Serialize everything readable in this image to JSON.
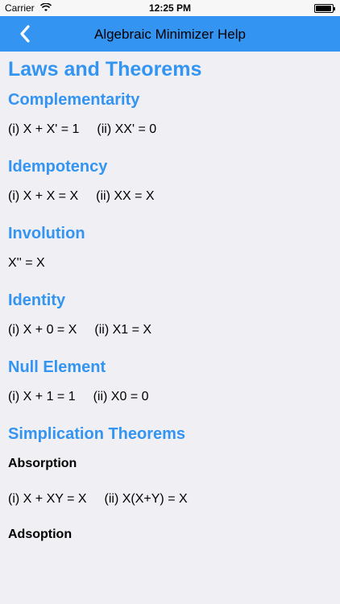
{
  "status": {
    "carrier": "Carrier",
    "time": "12:25 PM"
  },
  "nav": {
    "title": "Algebraic Minimizer Help"
  },
  "page": {
    "title": "Laws and Theorems",
    "sections": [
      {
        "title": "Complementarity",
        "items": [
          "(i) X + X' = 1",
          "(ii) XX' = 0"
        ]
      },
      {
        "title": "Idempotency",
        "items": [
          "(i) X + X = X",
          "(ii) XX = X"
        ]
      },
      {
        "title": "Involution",
        "items": [
          "X'' = X"
        ]
      },
      {
        "title": "Identity",
        "items": [
          "(i) X + 0 = X",
          "(ii) X1 = X"
        ]
      },
      {
        "title": "Null Element",
        "items": [
          "(i) X + 1 = 1",
          "(ii) X0 = 0"
        ]
      }
    ],
    "simplication": {
      "title": "Simplication Theorems",
      "absorption": {
        "title": "Absorption",
        "items": [
          "(i) X + XY = X",
          "(ii) X(X+Y) = X"
        ]
      },
      "adsoption": {
        "title": "Adsoption"
      }
    }
  },
  "colors": {
    "accent": "#3394f2",
    "background": "#efeff4"
  }
}
